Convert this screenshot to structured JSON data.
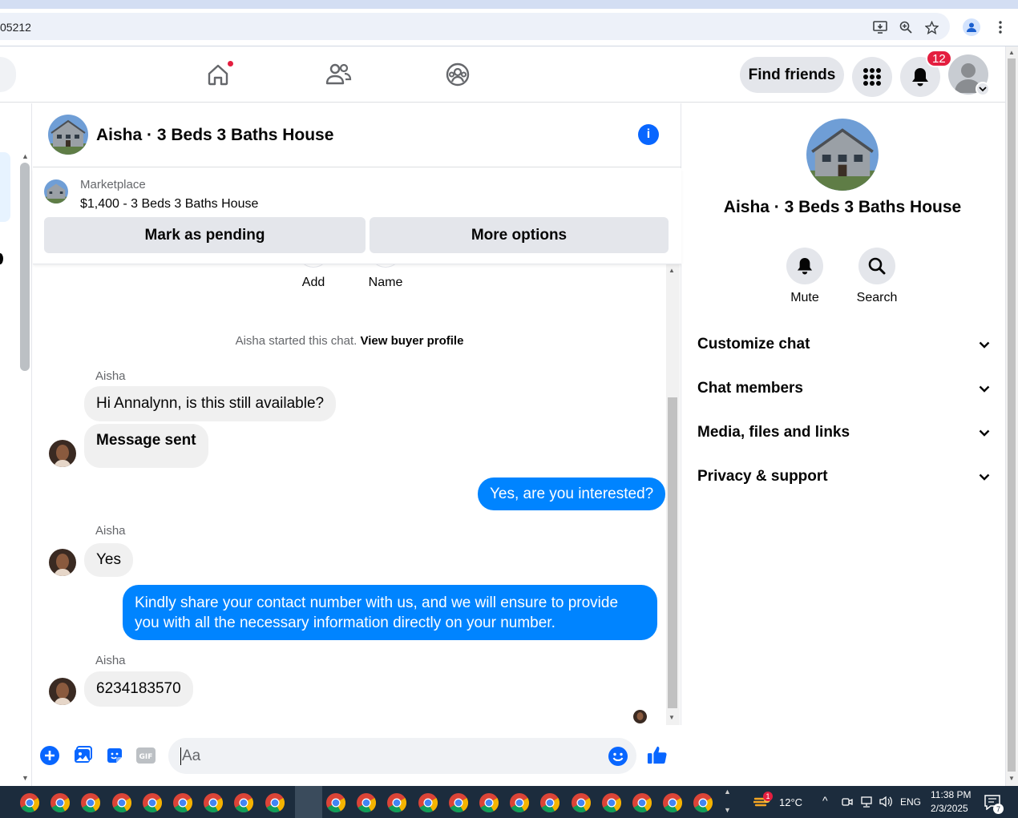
{
  "browser": {
    "url_fragment": "05212"
  },
  "header": {
    "find_friends_label": "Find friends",
    "notification_count": "12"
  },
  "chat": {
    "title": "Aisha · 3 Beds 3 Baths House",
    "marketplace_label": "Marketplace",
    "listing_title": "$1,400 - 3 Beds 3 Baths House",
    "mark_pending_label": "Mark as pending",
    "more_options_label": "More options",
    "add_label": "Add",
    "name_label": "Name",
    "started_text": "Aisha started this chat.",
    "view_buyer_profile": "View buyer profile",
    "messages": [
      {
        "sender": "Aisha",
        "text": "Hi Annalynn, is this still available?"
      },
      {
        "text": "Message sent"
      },
      {
        "outgoing": true,
        "text": "Yes, are you interested?"
      },
      {
        "sender": "Aisha",
        "text": "Yes"
      },
      {
        "outgoing": true,
        "text": "Kindly share your contact number with us, and we will ensure to provide you with all the necessary information directly on your number."
      },
      {
        "sender": "Aisha",
        "text": "6234183570"
      }
    ],
    "composer_placeholder": "Aa"
  },
  "right_panel": {
    "name": "Aisha · 3 Beds 3 Baths House",
    "mute_label": "Mute",
    "search_label": "Search",
    "sections": [
      "Customize chat",
      "Chat members",
      "Media, files and links",
      "Privacy & support"
    ]
  },
  "taskbar": {
    "weather": "12°C",
    "weather_badge": "1",
    "language": "ENG",
    "time": "11:38 PM",
    "date": "2/3/2025",
    "notifications": "7"
  },
  "colors": {
    "accent": "#0866ff",
    "outgoing_bubble": "#0084ff",
    "badge": "#e41e3f"
  }
}
